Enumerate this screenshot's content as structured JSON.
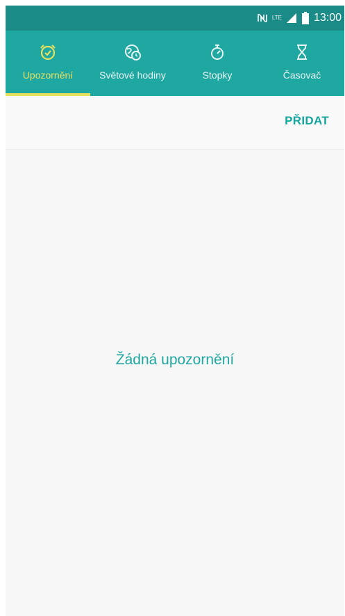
{
  "status_bar": {
    "time": "13:00",
    "network_label": "LTE",
    "icons": [
      "nfc-icon",
      "lte-icon",
      "signal-icon",
      "battery-icon"
    ]
  },
  "tabs": [
    {
      "label": "Upozornění",
      "icon": "alarm-clock-icon",
      "active": true
    },
    {
      "label": "Světové hodiny",
      "icon": "world-clock-icon",
      "active": false
    },
    {
      "label": "Stopky",
      "icon": "stopwatch-icon",
      "active": false
    },
    {
      "label": "Časovač",
      "icon": "hourglass-icon",
      "active": false
    }
  ],
  "toolbar": {
    "add_label": "PŘIDAT"
  },
  "content": {
    "empty_message": "Žádná upozornění"
  },
  "colors": {
    "status_bar": "#1a8b86",
    "tab_bar": "#1fa7a1",
    "active_tab": "#e6e060",
    "accent_text": "#1fa7a1"
  }
}
